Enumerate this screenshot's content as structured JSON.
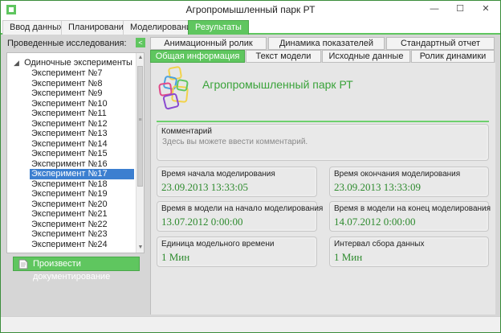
{
  "window": {
    "title": "Агропромышленный парк РТ",
    "minimize_label": "—",
    "maximize_label": "☐",
    "close_label": "✕"
  },
  "main_tabs": [
    {
      "label": "Ввод данных"
    },
    {
      "label": "Планирование"
    },
    {
      "label": "Моделирование"
    },
    {
      "label": "Результаты"
    }
  ],
  "left_panel": {
    "label": "Проведенные исследования:",
    "collapse_label": "<",
    "tree_root": "Одиночные эксперименты",
    "tree_root_toggle": "◢",
    "items": [
      "Эксперимент №7",
      "Эксперимент №8",
      "Эксперимент №9",
      "Эксперимент №10",
      "Эксперимент №11",
      "Эксперимент №12",
      "Эксперимент №13",
      "Эксперимент №14",
      "Эксперимент №15",
      "Эксперимент №16",
      "Эксперимент №17",
      "Эксперимент №18",
      "Эксперимент №19",
      "Эксперимент №20",
      "Эксперимент №21",
      "Эксперимент №22",
      "Эксперимент №23",
      "Эксперимент №24"
    ],
    "selected_item": "Эксперимент №17",
    "scroll_up": "▲",
    "scroll_down": "▼",
    "scroll_grip": "≡",
    "doc_button": "Произвести документирование"
  },
  "result_tabs": {
    "row1": [
      "Анимационный ролик",
      "Динамика показателей",
      "Стандартный отчет"
    ],
    "row2": [
      "Общая информация",
      "Текст модели",
      "Исходные данные",
      "Ролик динамики"
    ],
    "active": "Общая информация"
  },
  "info": {
    "heading": "Агропромышленный парк РТ",
    "comment_label": "Комментарий",
    "comment_placeholder": "Здесь вы можете ввести комментарий.",
    "fields": {
      "sim_start_label": "Время начала моделирования",
      "sim_start_value": "23.09.2013 13:33:05",
      "sim_end_label": "Время окончания моделирования",
      "sim_end_value": "23.09.2013 13:33:09",
      "model_start_label": "Время в модели на начало моделирования",
      "model_start_value": "13.07.2012 0:00:00",
      "model_end_label": "Время в модели на конец моделирования",
      "model_end_value": "14.07.2012 0:00:00",
      "time_unit_label": "Единица модельного времени",
      "time_unit_value": "1 Мин",
      "interval_label": "Интервал сбора данных",
      "interval_value": "1 Мин"
    }
  },
  "colors": {
    "accent": "#5fc65f",
    "value_text": "#2e8b2e",
    "selection": "#3c7fd0"
  }
}
